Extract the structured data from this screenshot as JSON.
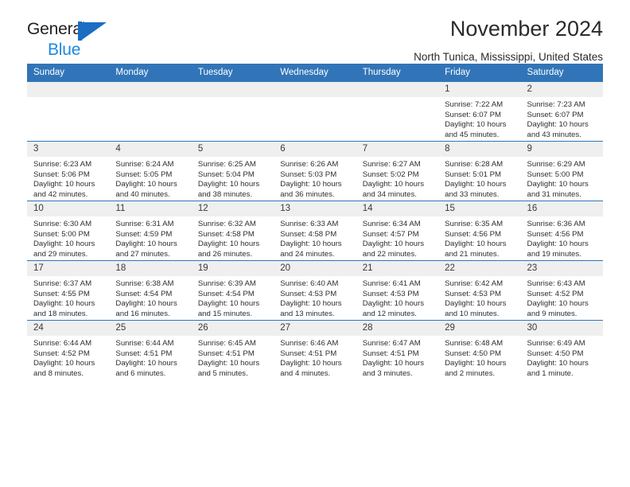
{
  "brand": {
    "name_part1": "General",
    "name_part2": "Blue",
    "mark": "triangle-logo"
  },
  "header": {
    "title": "November 2024",
    "subtitle": "North Tunica, Mississippi, United States"
  },
  "colors": {
    "header_blue": "#3175b8",
    "brand_blue_dark": "#1b6ec2",
    "brand_blue_light": "#1b8ae0",
    "daynum_background": "#efefef"
  },
  "weekday_headers": [
    "Sunday",
    "Monday",
    "Tuesday",
    "Wednesday",
    "Thursday",
    "Friday",
    "Saturday"
  ],
  "weeks": [
    [
      {
        "day": "",
        "sunrise": "",
        "sunset": "",
        "daylight": ""
      },
      {
        "day": "",
        "sunrise": "",
        "sunset": "",
        "daylight": ""
      },
      {
        "day": "",
        "sunrise": "",
        "sunset": "",
        "daylight": ""
      },
      {
        "day": "",
        "sunrise": "",
        "sunset": "",
        "daylight": ""
      },
      {
        "day": "",
        "sunrise": "",
        "sunset": "",
        "daylight": ""
      },
      {
        "day": "1",
        "sunrise": "Sunrise: 7:22 AM",
        "sunset": "Sunset: 6:07 PM",
        "daylight": "Daylight: 10 hours and 45 minutes."
      },
      {
        "day": "2",
        "sunrise": "Sunrise: 7:23 AM",
        "sunset": "Sunset: 6:07 PM",
        "daylight": "Daylight: 10 hours and 43 minutes."
      }
    ],
    [
      {
        "day": "3",
        "sunrise": "Sunrise: 6:23 AM",
        "sunset": "Sunset: 5:06 PM",
        "daylight": "Daylight: 10 hours and 42 minutes."
      },
      {
        "day": "4",
        "sunrise": "Sunrise: 6:24 AM",
        "sunset": "Sunset: 5:05 PM",
        "daylight": "Daylight: 10 hours and 40 minutes."
      },
      {
        "day": "5",
        "sunrise": "Sunrise: 6:25 AM",
        "sunset": "Sunset: 5:04 PM",
        "daylight": "Daylight: 10 hours and 38 minutes."
      },
      {
        "day": "6",
        "sunrise": "Sunrise: 6:26 AM",
        "sunset": "Sunset: 5:03 PM",
        "daylight": "Daylight: 10 hours and 36 minutes."
      },
      {
        "day": "7",
        "sunrise": "Sunrise: 6:27 AM",
        "sunset": "Sunset: 5:02 PM",
        "daylight": "Daylight: 10 hours and 34 minutes."
      },
      {
        "day": "8",
        "sunrise": "Sunrise: 6:28 AM",
        "sunset": "Sunset: 5:01 PM",
        "daylight": "Daylight: 10 hours and 33 minutes."
      },
      {
        "day": "9",
        "sunrise": "Sunrise: 6:29 AM",
        "sunset": "Sunset: 5:00 PM",
        "daylight": "Daylight: 10 hours and 31 minutes."
      }
    ],
    [
      {
        "day": "10",
        "sunrise": "Sunrise: 6:30 AM",
        "sunset": "Sunset: 5:00 PM",
        "daylight": "Daylight: 10 hours and 29 minutes."
      },
      {
        "day": "11",
        "sunrise": "Sunrise: 6:31 AM",
        "sunset": "Sunset: 4:59 PM",
        "daylight": "Daylight: 10 hours and 27 minutes."
      },
      {
        "day": "12",
        "sunrise": "Sunrise: 6:32 AM",
        "sunset": "Sunset: 4:58 PM",
        "daylight": "Daylight: 10 hours and 26 minutes."
      },
      {
        "day": "13",
        "sunrise": "Sunrise: 6:33 AM",
        "sunset": "Sunset: 4:58 PM",
        "daylight": "Daylight: 10 hours and 24 minutes."
      },
      {
        "day": "14",
        "sunrise": "Sunrise: 6:34 AM",
        "sunset": "Sunset: 4:57 PM",
        "daylight": "Daylight: 10 hours and 22 minutes."
      },
      {
        "day": "15",
        "sunrise": "Sunrise: 6:35 AM",
        "sunset": "Sunset: 4:56 PM",
        "daylight": "Daylight: 10 hours and 21 minutes."
      },
      {
        "day": "16",
        "sunrise": "Sunrise: 6:36 AM",
        "sunset": "Sunset: 4:56 PM",
        "daylight": "Daylight: 10 hours and 19 minutes."
      }
    ],
    [
      {
        "day": "17",
        "sunrise": "Sunrise: 6:37 AM",
        "sunset": "Sunset: 4:55 PM",
        "daylight": "Daylight: 10 hours and 18 minutes."
      },
      {
        "day": "18",
        "sunrise": "Sunrise: 6:38 AM",
        "sunset": "Sunset: 4:54 PM",
        "daylight": "Daylight: 10 hours and 16 minutes."
      },
      {
        "day": "19",
        "sunrise": "Sunrise: 6:39 AM",
        "sunset": "Sunset: 4:54 PM",
        "daylight": "Daylight: 10 hours and 15 minutes."
      },
      {
        "day": "20",
        "sunrise": "Sunrise: 6:40 AM",
        "sunset": "Sunset: 4:53 PM",
        "daylight": "Daylight: 10 hours and 13 minutes."
      },
      {
        "day": "21",
        "sunrise": "Sunrise: 6:41 AM",
        "sunset": "Sunset: 4:53 PM",
        "daylight": "Daylight: 10 hours and 12 minutes."
      },
      {
        "day": "22",
        "sunrise": "Sunrise: 6:42 AM",
        "sunset": "Sunset: 4:53 PM",
        "daylight": "Daylight: 10 hours and 10 minutes."
      },
      {
        "day": "23",
        "sunrise": "Sunrise: 6:43 AM",
        "sunset": "Sunset: 4:52 PM",
        "daylight": "Daylight: 10 hours and 9 minutes."
      }
    ],
    [
      {
        "day": "24",
        "sunrise": "Sunrise: 6:44 AM",
        "sunset": "Sunset: 4:52 PM",
        "daylight": "Daylight: 10 hours and 8 minutes."
      },
      {
        "day": "25",
        "sunrise": "Sunrise: 6:44 AM",
        "sunset": "Sunset: 4:51 PM",
        "daylight": "Daylight: 10 hours and 6 minutes."
      },
      {
        "day": "26",
        "sunrise": "Sunrise: 6:45 AM",
        "sunset": "Sunset: 4:51 PM",
        "daylight": "Daylight: 10 hours and 5 minutes."
      },
      {
        "day": "27",
        "sunrise": "Sunrise: 6:46 AM",
        "sunset": "Sunset: 4:51 PM",
        "daylight": "Daylight: 10 hours and 4 minutes."
      },
      {
        "day": "28",
        "sunrise": "Sunrise: 6:47 AM",
        "sunset": "Sunset: 4:51 PM",
        "daylight": "Daylight: 10 hours and 3 minutes."
      },
      {
        "day": "29",
        "sunrise": "Sunrise: 6:48 AM",
        "sunset": "Sunset: 4:50 PM",
        "daylight": "Daylight: 10 hours and 2 minutes."
      },
      {
        "day": "30",
        "sunrise": "Sunrise: 6:49 AM",
        "sunset": "Sunset: 4:50 PM",
        "daylight": "Daylight: 10 hours and 1 minute."
      }
    ]
  ]
}
